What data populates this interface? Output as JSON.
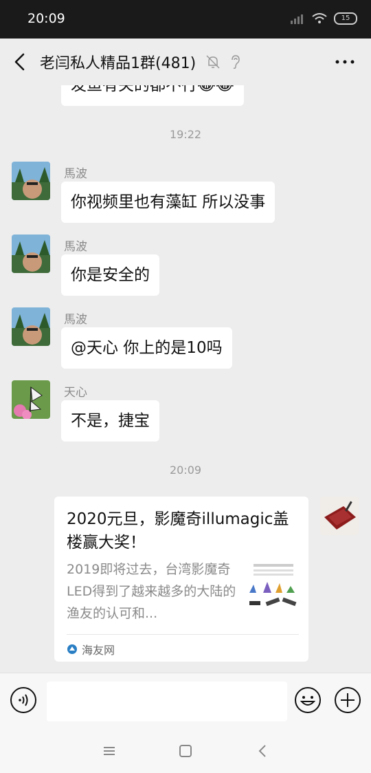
{
  "status_bar": {
    "time": "20:09",
    "battery": "15"
  },
  "header": {
    "title": "老闫私人精品1群(481)"
  },
  "chat": {
    "partial_message": "发鱼有关的都不行😂😂",
    "time_1": "19:22",
    "messages": [
      {
        "sender": "馬波",
        "text": "你视频里也有藻缸 所以没事"
      },
      {
        "sender": "馬波",
        "text": "你是安全的"
      },
      {
        "sender": "馬波",
        "text": "@天心  你上的是10吗"
      },
      {
        "sender": "天心",
        "text": "不是，捷宝"
      }
    ],
    "time_2": "20:09",
    "card": {
      "title": "2020元旦，影魔奇illumagic盖楼赢大奖！",
      "description": "2019即将过去，台湾影魔奇LED得到了越来越多的大陆的渔友的认可和...",
      "source": "海友网"
    }
  },
  "input": {
    "placeholder": ""
  },
  "icons": {
    "back": "back-arrow-icon",
    "muted": "bell-muted-icon",
    "ear": "ear-icon",
    "more": "more-dots-icon",
    "voice": "voice-icon",
    "emoji": "emoji-icon",
    "plus": "plus-icon"
  },
  "colors": {
    "chat_bg": "#ededed",
    "bubble": "#ffffff",
    "status_bar": "#1a1a1a"
  }
}
